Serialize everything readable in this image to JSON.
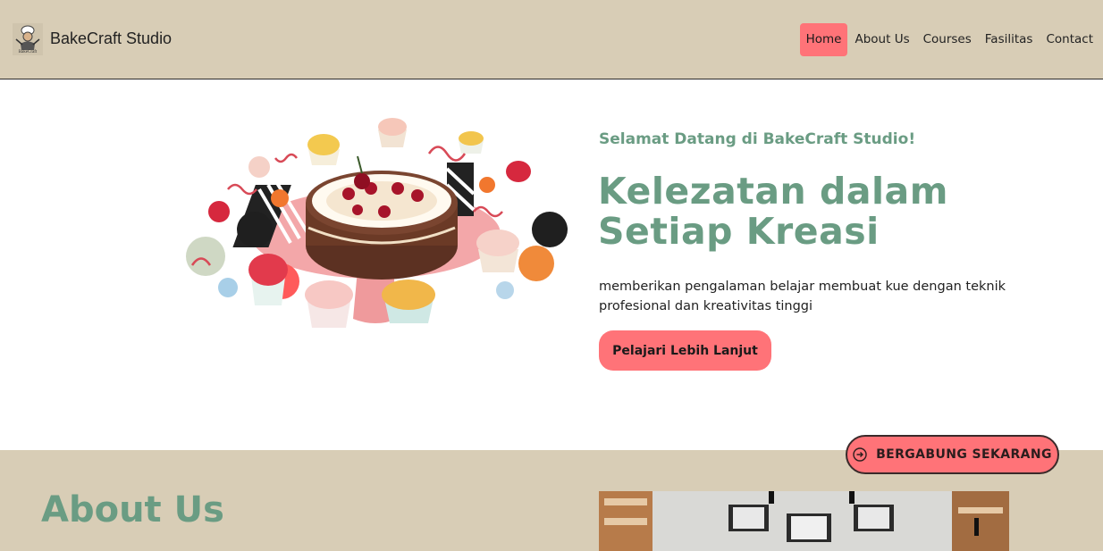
{
  "header": {
    "brand": "BakeCraft Studio",
    "logo_icon": "chef-logo-icon",
    "nav": [
      {
        "label": "Home",
        "active": true
      },
      {
        "label": "About Us",
        "active": false
      },
      {
        "label": "Courses",
        "active": false
      },
      {
        "label": "Fasilitas",
        "active": false
      },
      {
        "label": "Contact",
        "active": false
      }
    ]
  },
  "hero": {
    "subtitle": "Selamat Datang di BakeCraft Studio!",
    "title": "Kelezatan dalam Setiap Kreasi",
    "description": "memberikan pengalaman belajar membuat kue dengan teknik profesional dan kreativitas tinggi",
    "cta_label": "Pelajari Lebih Lanjut",
    "illustration": "cake-with-cupcakes-illustration"
  },
  "floating_button": {
    "label": "BERGABUNG SEKARANG",
    "icon": "arrow-circle-icon"
  },
  "about": {
    "title": "About Us",
    "photo": "bakery-interior-photo"
  },
  "colors": {
    "header_bg": "#d8cdb6",
    "accent_pink": "#ff7378",
    "heading_green": "#6a9c83"
  }
}
